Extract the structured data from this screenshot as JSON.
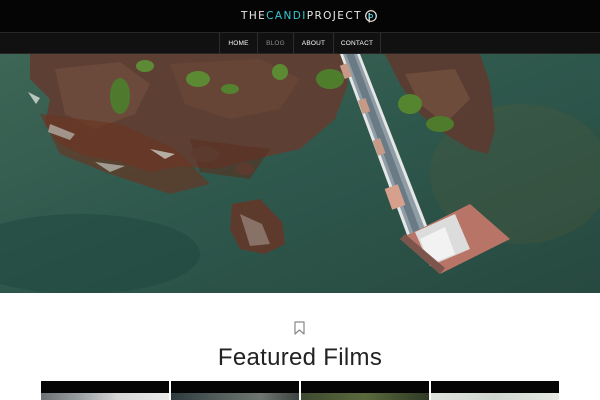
{
  "header": {
    "logo_part1": "THE",
    "logo_part2": "CANDI",
    "logo_part3": "PROJECT",
    "logo_icon": "candi-logo-mark",
    "accent_color": "#35c8d4"
  },
  "nav": {
    "items": [
      {
        "label": "HOME"
      },
      {
        "label": "BLOG"
      },
      {
        "label": "ABOUT"
      },
      {
        "label": "CONTACT"
      }
    ],
    "active_item": "BLOG"
  },
  "hero": {
    "image": "aerial-view-of-pier-over-rocky-shoreline"
  },
  "featured": {
    "icon": "bookmark-icon",
    "title": "Featured Films",
    "thumbnails": [
      "film-thumbnail-1",
      "film-thumbnail-2",
      "film-thumbnail-3",
      "film-thumbnail-4"
    ]
  }
}
